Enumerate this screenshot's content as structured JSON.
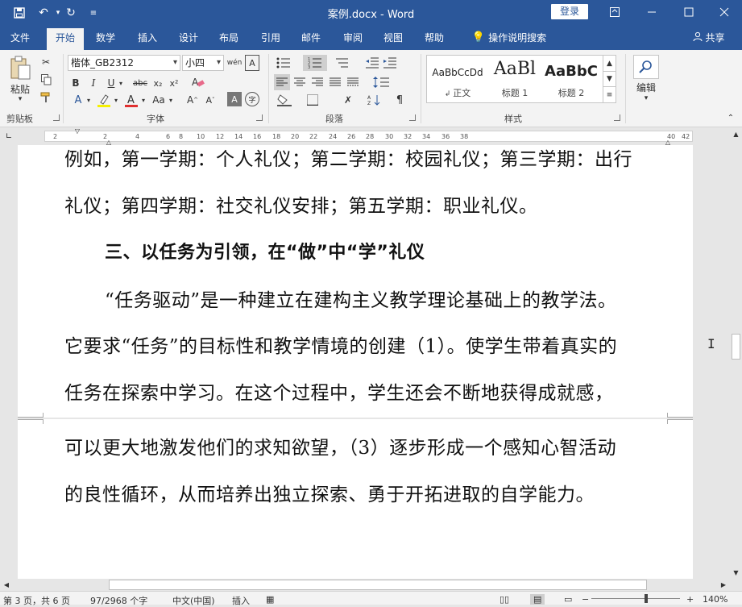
{
  "app": {
    "title": "案例.docx  -  Word",
    "login_label": "登录"
  },
  "tabs": [
    {
      "label": "文件"
    },
    {
      "label": "开始"
    },
    {
      "label": "数学"
    },
    {
      "label": "插入"
    },
    {
      "label": "设计"
    },
    {
      "label": "布局"
    },
    {
      "label": "引用"
    },
    {
      "label": "邮件"
    },
    {
      "label": "审阅"
    },
    {
      "label": "视图"
    },
    {
      "label": "帮助"
    },
    {
      "label": "操作说明搜索"
    },
    {
      "label": "共享"
    }
  ],
  "ribbon": {
    "clipboard": {
      "paste_label": "粘贴",
      "group_label": "剪贴板"
    },
    "font": {
      "font_name": "楷体_GB2312",
      "font_size": "小四",
      "group_label": "字体",
      "font_color": "#e03030",
      "highlight_color": "#f5f000"
    },
    "paragraph": {
      "group_label": "段落"
    },
    "styles": {
      "group_label": "样式",
      "items": [
        {
          "sample": "AaBbCcDd",
          "name": "正文"
        },
        {
          "sample": "AaBl",
          "name": "标题 1"
        },
        {
          "sample": "AaBbC",
          "name": "标题 2"
        }
      ]
    },
    "editing": {
      "label": "编辑"
    }
  },
  "ruler": {
    "numbers": [
      "2",
      "2",
      "4",
      "6",
      "8",
      "10",
      "12",
      "14",
      "16",
      "18",
      "20",
      "22",
      "24",
      "26",
      "28",
      "30",
      "32",
      "34",
      "36",
      "38",
      "40",
      "42"
    ]
  },
  "document": {
    "page1_lines": [
      "例如，第一学期：个人礼仪；第二学期：校园礼仪；第三学期：出行",
      "礼仪；第四学期：社交礼仪安排；第五学期：职业礼仪。",
      "三、以任务为引领，在“做”中“学”礼仪",
      "“任务驱动”是一种建立在建构主义教学理论基础上的教学法。",
      "它要求“任务”的目标性和教学情境的创建（1）。使学生带着真实的",
      "任务在探索中学习。在这个过程中，学生还会不断地获得成就感，"
    ],
    "page2_lines": [
      "可以更大地激发他们的求知欲望，（3）逐步形成一个感知心智活动",
      "的良性循环，从而培养出独立探索、勇于开拓进取的自学能力。"
    ]
  },
  "status": {
    "page": "第 3 页，共 6 页",
    "words": "97/2968 个字",
    "language": "中文(中国)",
    "mode": "插入",
    "zoom": "140%"
  },
  "colors": {
    "title_bar": "#2b579a",
    "ribbon_bg": "#f3f3f3"
  }
}
